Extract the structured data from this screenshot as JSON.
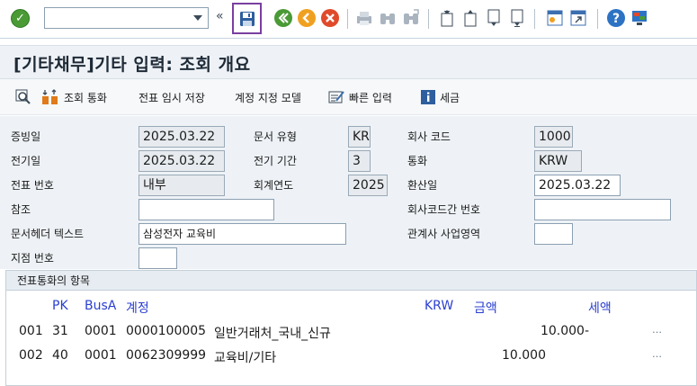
{
  "toolbar": {
    "command_value": "",
    "collapse_glyph": "«",
    "icons": [
      "ok-icon",
      "save-icon",
      "back-icon",
      "exit-icon",
      "cancel-icon",
      "print-icon",
      "find-icon",
      "find-next-icon",
      "first-page-icon",
      "prev-page-icon",
      "next-page-icon",
      "last-page-icon",
      "new-session-icon",
      "shortcut-icon",
      "help-icon",
      "customize-icon"
    ]
  },
  "title": "[기타채무]기타 입력: 조회 개요",
  "app_toolbar": {
    "doc_currency": "조회 통화",
    "park": "전표 임시 저장",
    "acct_model": "계정 지정 모델",
    "fast_entry": "빠른 입력",
    "tax": "세금"
  },
  "header": {
    "doc_date": {
      "label": "증빙일",
      "value": "2025.03.22"
    },
    "doc_type": {
      "label": "문서 유형",
      "value": "KR"
    },
    "company_code": {
      "label": "회사 코드",
      "value": "1000"
    },
    "posting_date": {
      "label": "전기일",
      "value": "2025.03.22"
    },
    "period": {
      "label": "전기 기간",
      "value": "3"
    },
    "currency": {
      "label": "통화",
      "value": "KRW"
    },
    "doc_number": {
      "label": "전표 번호",
      "value": "내부"
    },
    "fiscal_year": {
      "label": "회계연도",
      "value": "2025"
    },
    "translation_date": {
      "label": "환산일",
      "value": "2025.03.22"
    },
    "reference": {
      "label": "참조",
      "value": ""
    },
    "intercompany": {
      "label": "회사코드간 번호",
      "value": ""
    },
    "header_text": {
      "label": "문서헤더 텍스트",
      "value": "삼성전자 교육비"
    },
    "trading_partner": {
      "label": "관계사 사업영역",
      "value": ""
    },
    "branch": {
      "label": "지점 번호",
      "value": ""
    }
  },
  "items": {
    "section_title": "전표통화의 항목",
    "columns": {
      "pk": "PK",
      "busa": "BusA",
      "account": "계정",
      "currency": "KRW",
      "amount": "금액",
      "tax": "세액"
    },
    "rows": [
      {
        "no": "001",
        "pk": "31",
        "busa": "0001",
        "account": "0000100005",
        "desc": "일반거래처_국내_신규",
        "amount": "10.000-",
        "more": "…"
      },
      {
        "no": "002",
        "pk": "40",
        "busa": "0001",
        "account": "0062309999",
        "desc": "교육비/기타",
        "amount": "10.000",
        "more": "…"
      }
    ]
  },
  "colors": {
    "title_bg": "#eef2f6",
    "column_header": "#2a3fd0",
    "save_highlight": "#7a3fa0"
  }
}
